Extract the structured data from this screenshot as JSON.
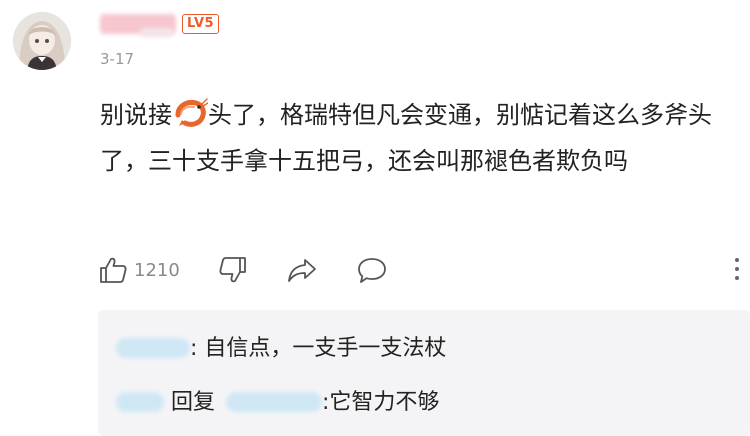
{
  "post": {
    "user": {
      "avatar_icon": "avatar-anime-girl-icon",
      "level_badge": "LV5",
      "watermark_text": "游民"
    },
    "date": "3-17",
    "comment": {
      "part1": "别说接",
      "emoji_icon": "shrimp-emoji-icon",
      "part2": "头了，格瑞特但凡会变通，别惦记着这么多斧头了，三十支手拿十五把弓，还会叫那褪色者欺负吗"
    },
    "actions": {
      "like_icon": "thumbs-up-icon",
      "like_count": "1210",
      "dislike_icon": "thumbs-down-icon",
      "share_icon": "share-icon",
      "comment_icon": "comment-bubble-icon",
      "more_icon": "more-vertical-icon"
    }
  },
  "replies": [
    {
      "text": ": 自信点，一支手一支法杖"
    },
    {
      "connector": "回复",
      "text": ":它智力不够"
    }
  ],
  "colors": {
    "level_badge": "#f05a28",
    "reply_background": "#f4f4f6",
    "secondary_text": "#999999"
  }
}
